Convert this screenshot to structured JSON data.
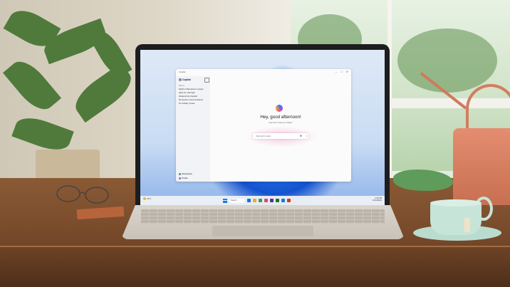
{
  "app": {
    "title": "Copilot",
    "window_controls": [
      "–",
      "□",
      "✕"
    ]
  },
  "sidebar": {
    "logo_label": "Copilot",
    "section_heading": "Recent",
    "items": [
      {
        "label": "Flights to Barcelona in August"
      },
      {
        "label": "Ideas for a fall night"
      },
      {
        "label": "Weekend trip checklist"
      },
      {
        "label": "My favorite recommendations"
      },
      {
        "label": "Fun holiday movies"
      }
    ],
    "workspace_label": "Workspace",
    "user_label": "Profile"
  },
  "main": {
    "greeting": "Hey, good afternoon!",
    "subtitle": "How can I help you today?",
    "input_placeholder": "Chat with Copilot"
  },
  "taskbar": {
    "weather": "72°F",
    "search_placeholder": "Search",
    "tray_time": "2:30 PM",
    "tray_date": "10/14/2024",
    "app_icon_colors": [
      "#0078d4",
      "#f2b01e",
      "#2da44e",
      "#e74856",
      "#5c2d91",
      "#0f7b0f",
      "#1a73e8",
      "#d83b01"
    ]
  }
}
